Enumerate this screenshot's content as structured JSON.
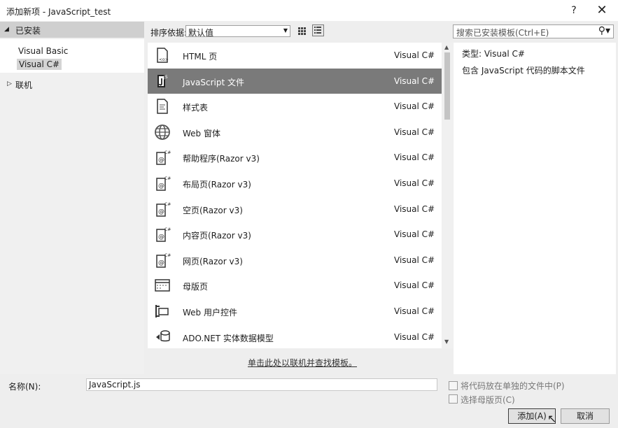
{
  "window": {
    "title": "添加新项 - JavaScript_test",
    "help_label": "?",
    "close_label": "✕"
  },
  "nav": {
    "installed": "已安装",
    "items": [
      "Visual Basic",
      "Visual C#"
    ],
    "selected": "Visual C#",
    "online": "联机"
  },
  "toolbar": {
    "sort_label": "排序依据:",
    "sort_value": "默认值"
  },
  "search": {
    "placeholder": "搜索已安装模板(Ctrl+E)"
  },
  "templates": [
    {
      "name": "HTML 页",
      "lang": "Visual C#",
      "icon": "html-page-icon"
    },
    {
      "name": "JavaScript 文件",
      "lang": "Visual C#",
      "icon": "javascript-file-icon",
      "selected": true
    },
    {
      "name": "样式表",
      "lang": "Visual C#",
      "icon": "stylesheet-icon"
    },
    {
      "name": "Web 窗体",
      "lang": "Visual C#",
      "icon": "web-form-icon"
    },
    {
      "name": "帮助程序(Razor v3)",
      "lang": "Visual C#",
      "icon": "razor-icon"
    },
    {
      "name": "布局页(Razor v3)",
      "lang": "Visual C#",
      "icon": "razor-icon"
    },
    {
      "name": "空页(Razor v3)",
      "lang": "Visual C#",
      "icon": "razor-icon"
    },
    {
      "name": "内容页(Razor v3)",
      "lang": "Visual C#",
      "icon": "razor-icon"
    },
    {
      "name": "网页(Razor v3)",
      "lang": "Visual C#",
      "icon": "razor-icon"
    },
    {
      "name": "母版页",
      "lang": "Visual C#",
      "icon": "master-page-icon"
    },
    {
      "name": "Web 用户控件",
      "lang": "Visual C#",
      "icon": "user-control-icon"
    },
    {
      "name": "ADO.NET 实体数据模型",
      "lang": "Visual C#",
      "icon": "entity-model-icon"
    }
  ],
  "online_link": "单击此处以联机并查找模板。",
  "description": {
    "type": "类型:  Visual C#",
    "text": "包含 JavaScript 代码的脚本文件"
  },
  "footer": {
    "name_label": "名称(N):",
    "name_value": "JavaScript.js",
    "checkbox1": "将代码放在单独的文件中(P)",
    "checkbox2": "选择母版页(C)",
    "add_label": "添加(A)",
    "cancel_label": "取消"
  }
}
